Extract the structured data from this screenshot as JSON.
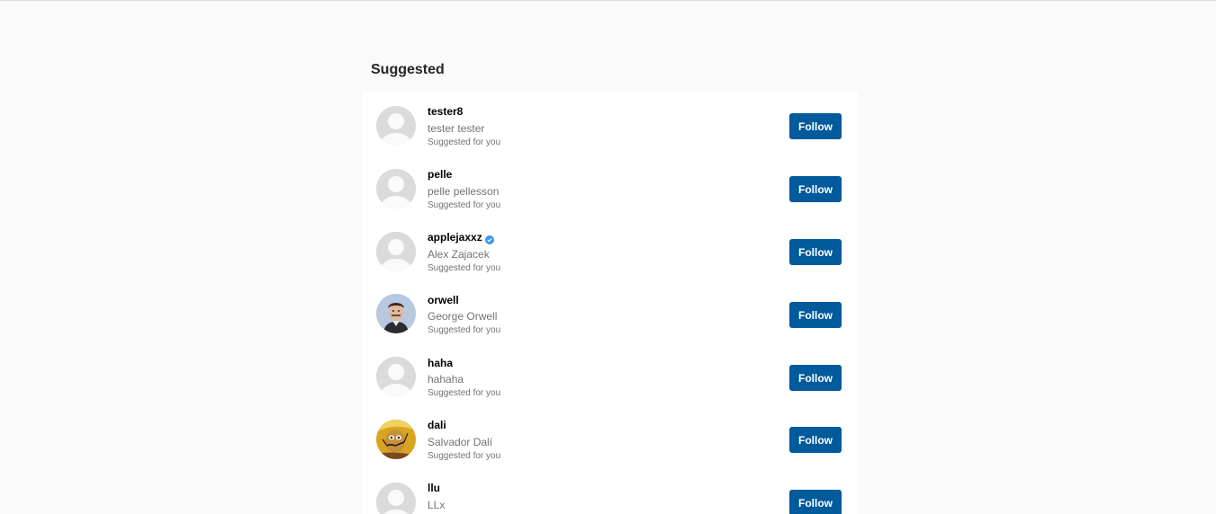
{
  "section": {
    "title": "Suggested"
  },
  "suggestions": [
    {
      "username": "tester8",
      "full_name": "tester tester",
      "reason": "Suggested for you",
      "verified": false,
      "avatar": "default-avatar",
      "button": "Follow"
    },
    {
      "username": "pelle",
      "full_name": "pelle pellesson",
      "reason": "Suggested for you",
      "verified": false,
      "avatar": "default-avatar",
      "button": "Follow"
    },
    {
      "username": "applejaxxz",
      "full_name": "Alex Zajacek",
      "reason": "Suggested for you",
      "verified": true,
      "avatar": "default-avatar",
      "button": "Follow"
    },
    {
      "username": "orwell",
      "full_name": "George Orwell",
      "reason": "Suggested for you",
      "verified": false,
      "avatar": "portrait-photo",
      "button": "Follow"
    },
    {
      "username": "haha",
      "full_name": "hahaha",
      "reason": "Suggested for you",
      "verified": false,
      "avatar": "default-avatar",
      "button": "Follow"
    },
    {
      "username": "dali",
      "full_name": "Salvador Dalí",
      "reason": "Suggested for you",
      "verified": false,
      "avatar": "painting-photo",
      "button": "Follow"
    },
    {
      "username": "llu",
      "full_name": "LLx",
      "reason": "",
      "verified": false,
      "avatar": "default-avatar",
      "button": "Follow"
    }
  ],
  "colors": {
    "background": "#fafafa",
    "card": "#ffffff",
    "follow_button": "#005a9c",
    "verified_badge": "#3897f0",
    "default_avatar": "#dbdbdb"
  }
}
